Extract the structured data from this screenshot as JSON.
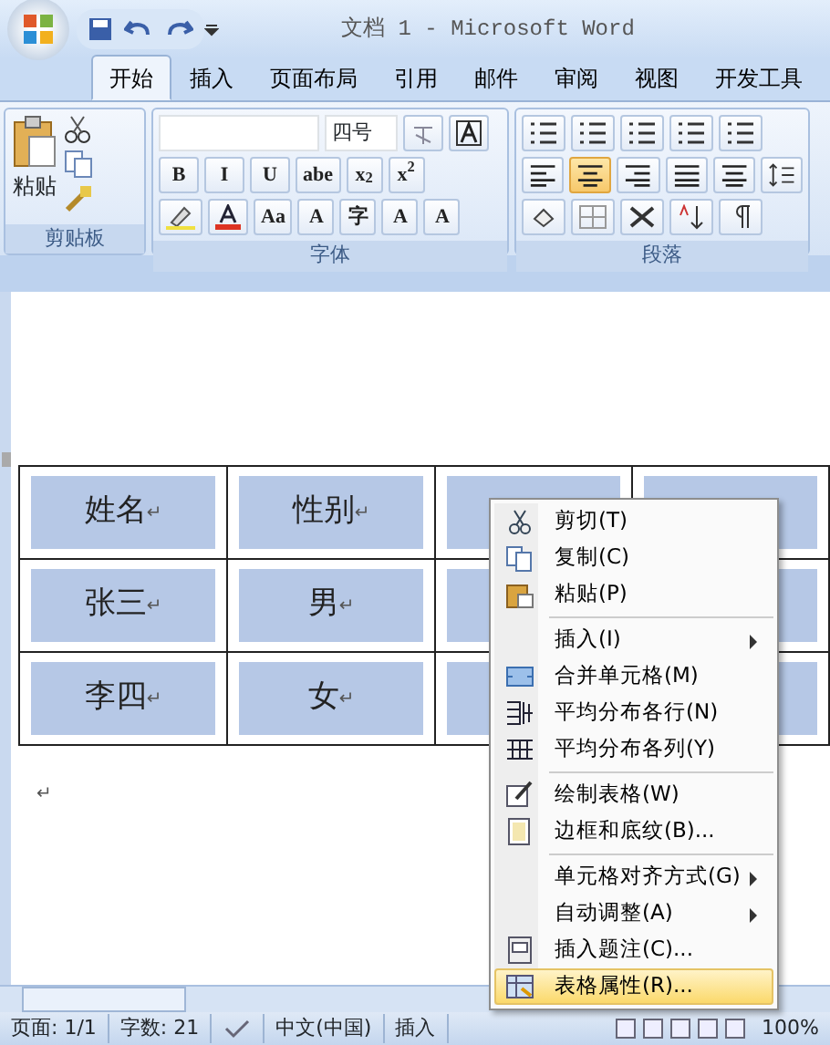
{
  "window": {
    "title": "文档 1 - Microsoft Word"
  },
  "tabs": [
    {
      "label": "开始",
      "selected": true
    },
    {
      "label": "插入",
      "selected": false
    },
    {
      "label": "页面布局",
      "selected": false
    },
    {
      "label": "引用",
      "selected": false
    },
    {
      "label": "邮件",
      "selected": false
    },
    {
      "label": "审阅",
      "selected": false
    },
    {
      "label": "视图",
      "selected": false
    },
    {
      "label": "开发工具",
      "selected": false
    }
  ],
  "ribbon": {
    "clipboard": {
      "title": "剪贴板",
      "paste_label": "粘贴"
    },
    "font": {
      "title": "字体",
      "size": "四号",
      "buttons": [
        "B",
        "I",
        "U",
        "abe",
        "x$_{2}$",
        "x$^{2}$",
        "Aa",
        "A",
        "字",
        "A",
        "A"
      ]
    },
    "paragraph": {
      "title": "段落",
      "alignment": [
        {
          "selected": false
        },
        {
          "selected": true
        },
        {
          "selected": false
        },
        {
          "selected": false
        },
        {
          "selected": false
        }
      ]
    }
  },
  "table": {
    "rows": [
      [
        "姓名",
        "性别"
      ],
      [
        "张三",
        "男"
      ],
      [
        "李四",
        "女"
      ]
    ],
    "mark": "↵"
  },
  "paragraph_mark": "↵",
  "context_menu": {
    "items": [
      {
        "kind": "item",
        "label": "剪切(T)",
        "submenu": false,
        "selected": false
      },
      {
        "kind": "item",
        "label": "复制(C)",
        "submenu": false,
        "selected": false
      },
      {
        "kind": "item",
        "label": "粘贴(P)",
        "submenu": false,
        "selected": false
      },
      {
        "kind": "separator"
      },
      {
        "kind": "item",
        "label": "插入(I)",
        "submenu": true,
        "selected": false
      },
      {
        "kind": "item",
        "label": "合并单元格(M)",
        "submenu": false,
        "selected": false
      },
      {
        "kind": "item",
        "label": "平均分布各行(N)",
        "submenu": false,
        "selected": false
      },
      {
        "kind": "item",
        "label": "平均分布各列(Y)",
        "submenu": false,
        "selected": false
      },
      {
        "kind": "separator"
      },
      {
        "kind": "item",
        "label": "绘制表格(W)",
        "submenu": false,
        "selected": false
      },
      {
        "kind": "item",
        "label": "边框和底纹(B)...",
        "submenu": false,
        "selected": false
      },
      {
        "kind": "separator"
      },
      {
        "kind": "item",
        "label": "单元格对齐方式(G)",
        "submenu": true,
        "selected": false
      },
      {
        "kind": "item",
        "label": "自动调整(A)",
        "submenu": true,
        "selected": false
      },
      {
        "kind": "item",
        "label": "插入题注(C)...",
        "submenu": false,
        "selected": false
      },
      {
        "kind": "item",
        "label": "表格属性(R)...",
        "submenu": false,
        "selected": true
      }
    ]
  },
  "status_bar": {
    "page": "页面: 1/1",
    "words": "字数: 21",
    "language": "中文(中国)",
    "mode": "插入",
    "zoom": "100%"
  }
}
